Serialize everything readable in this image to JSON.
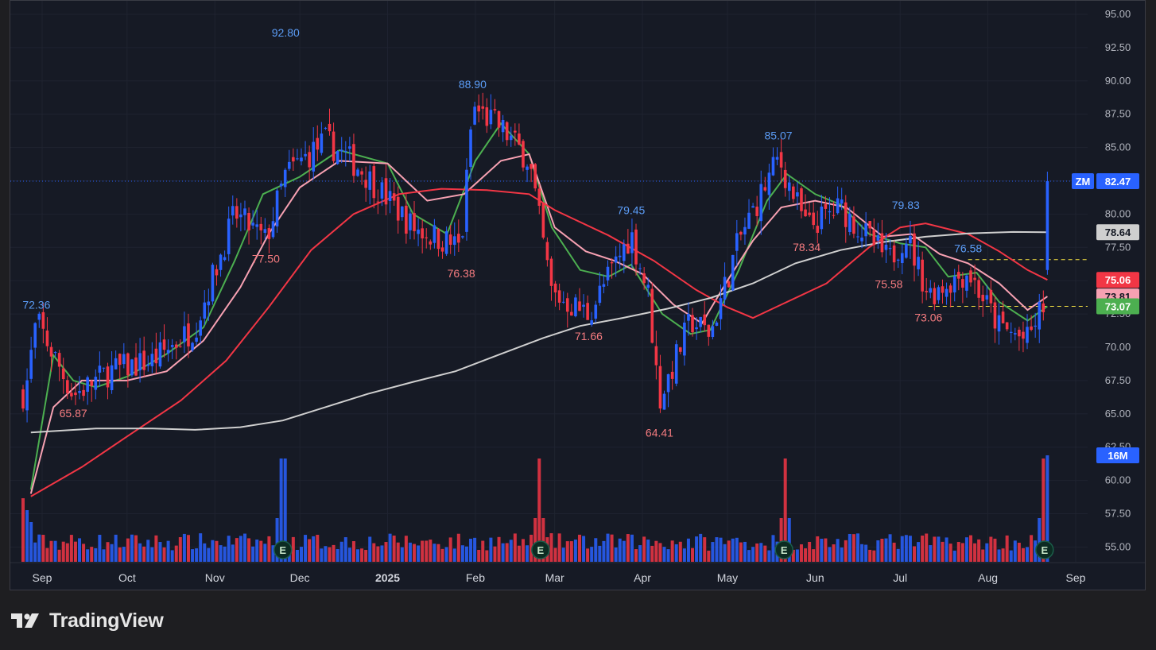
{
  "brand": {
    "name": "TradingView"
  },
  "chart_data": {
    "type": "candlestick",
    "symbol": "ZM",
    "last_price": "82.47",
    "ylim": [
      53.5,
      95.8
    ],
    "y_ticks": [
      "55.00",
      "57.50",
      "60.00",
      "62.50",
      "65.00",
      "67.50",
      "70.00",
      "72.50",
      "75.00",
      "77.50",
      "80.00",
      "82.50",
      "85.00",
      "87.50",
      "90.00",
      "92.50",
      "95.00"
    ],
    "x_ticks": [
      "Sep",
      "Oct",
      "Nov",
      "Dec",
      "2025",
      "Feb",
      "Mar",
      "Apr",
      "May",
      "Jun",
      "Jul",
      "Aug",
      "Sep"
    ],
    "bold_x_ticks": [
      "2025"
    ],
    "price_labels": [
      {
        "label": "ZM",
        "value": "82.47",
        "y": 82.47,
        "color": "#2962ff"
      },
      {
        "label": "",
        "value": "78.64",
        "y": 78.64,
        "color": "#cfcfcf"
      },
      {
        "label": "",
        "value": "75.06",
        "y": 75.06,
        "color": "#f23645"
      },
      {
        "label": "",
        "value": "73.81",
        "y": 73.81,
        "color": "#f7a1b2"
      },
      {
        "label": "",
        "value": "73.07",
        "y": 73.07,
        "color": "#4caf50"
      }
    ],
    "volume_label": "16M",
    "high_low_annotations": [
      {
        "text": "72.36",
        "x": "Aug 30",
        "y": 72.36,
        "kind": "high"
      },
      {
        "text": "65.87",
        "x": "Sep 12",
        "y": 65.87,
        "kind": "low"
      },
      {
        "text": "92.80",
        "x": "Nov 26",
        "y": 92.8,
        "kind": "high"
      },
      {
        "text": "77.50",
        "x": "Nov 19",
        "y": 77.5,
        "kind": "low"
      },
      {
        "text": "88.90",
        "x": "Jan 31",
        "y": 88.9,
        "kind": "high"
      },
      {
        "text": "76.38",
        "x": "Jan 27",
        "y": 76.38,
        "kind": "low"
      },
      {
        "text": "79.45",
        "x": "Mar 28",
        "y": 79.45,
        "kind": "high"
      },
      {
        "text": "71.66",
        "x": "Mar 13",
        "y": 71.66,
        "kind": "low"
      },
      {
        "text": "64.41",
        "x": "Apr 7",
        "y": 64.41,
        "kind": "low"
      },
      {
        "text": "85.07",
        "x": "May 19",
        "y": 85.07,
        "kind": "high"
      },
      {
        "text": "78.34",
        "x": "May 29",
        "y": 78.34,
        "kind": "low"
      },
      {
        "text": "75.58",
        "x": "Jun 27",
        "y": 75.58,
        "kind": "low"
      },
      {
        "text": "79.83",
        "x": "Jul 3",
        "y": 79.83,
        "kind": "high"
      },
      {
        "text": "73.06",
        "x": "Jul 11",
        "y": 73.06,
        "kind": "low"
      },
      {
        "text": "76.58",
        "x": "Jul 25",
        "y": 76.58,
        "kind": "high"
      }
    ],
    "earnings_markers": [
      "Nov 25",
      "Feb 24",
      "May 21",
      "Aug 21"
    ],
    "earnings_marker_letter": "E",
    "horizontal_lines": [
      {
        "y": 76.58,
        "color": "#f5e142",
        "style": "dashed"
      },
      {
        "y": 73.07,
        "color": "#f5e142",
        "style": "dashed"
      },
      {
        "y": 82.47,
        "color": "#2962ff",
        "style": "dotted"
      }
    ],
    "moving_averages": [
      {
        "color": "#4caf50",
        "points": [
          [
            "Aug 28",
            59.3
          ],
          [
            "Sep 5",
            69.4
          ],
          [
            "Sep 12",
            67.5
          ],
          [
            "Sep 20",
            67.0
          ],
          [
            "Oct 1",
            67.8
          ],
          [
            "Oct 15",
            69.5
          ],
          [
            "Oct 28",
            71.5
          ],
          [
            "Nov 8",
            76.5
          ],
          [
            "Nov 18",
            81.5
          ],
          [
            "Dec 1",
            82.8
          ],
          [
            "Dec 15",
            84.8
          ],
          [
            "Jan 1",
            83.8
          ],
          [
            "Jan 10",
            80.0
          ],
          [
            "Jan 22",
            78.5
          ],
          [
            "Feb 1",
            84.0
          ],
          [
            "Feb 10",
            86.8
          ],
          [
            "Feb 20",
            84.5
          ],
          [
            "Feb 28",
            79.0
          ],
          [
            "Mar 10",
            75.8
          ],
          [
            "Mar 20",
            75.3
          ],
          [
            "Mar 28",
            76.2
          ],
          [
            "Apr 8",
            72.5
          ],
          [
            "Apr 18",
            71.0
          ],
          [
            "Apr 25",
            71.3
          ],
          [
            "May 5",
            75.8
          ],
          [
            "May 15",
            81.0
          ],
          [
            "May 22",
            83.0
          ],
          [
            "Jun 1",
            81.5
          ],
          [
            "Jun 10",
            80.7
          ],
          [
            "Jun 20",
            78.5
          ],
          [
            "Jul 1",
            77.8
          ],
          [
            "Jul 10",
            77.5
          ],
          [
            "Jul 18",
            75.3
          ],
          [
            "Jul 28",
            75.6
          ],
          [
            "Aug 5",
            73.4
          ],
          [
            "Aug 15",
            72.0
          ],
          [
            "Aug 22",
            73.07
          ]
        ]
      },
      {
        "color": "#f7a1b2",
        "points": [
          [
            "Aug 28",
            59.0
          ],
          [
            "Sep 5",
            65.5
          ],
          [
            "Sep 15",
            67.5
          ],
          [
            "Oct 1",
            67.5
          ],
          [
            "Oct 15",
            68.2
          ],
          [
            "Oct 28",
            70.5
          ],
          [
            "Nov 10",
            74.5
          ],
          [
            "Nov 20",
            78.5
          ],
          [
            "Dec 1",
            82.0
          ],
          [
            "Dec 15",
            84.0
          ],
          [
            "Jan 1",
            83.8
          ],
          [
            "Jan 15",
            81.0
          ],
          [
            "Jan 28",
            81.5
          ],
          [
            "Feb 10",
            84.0
          ],
          [
            "Feb 20",
            84.5
          ],
          [
            "Mar 1",
            79.0
          ],
          [
            "Mar 12",
            77.2
          ],
          [
            "Mar 22",
            76.5
          ],
          [
            "Apr 1",
            75.5
          ],
          [
            "Apr 12",
            73.2
          ],
          [
            "Apr 22",
            71.8
          ],
          [
            "May 1",
            75.0
          ],
          [
            "May 10",
            78.0
          ],
          [
            "May 20",
            80.5
          ],
          [
            "Jun 1",
            81.0
          ],
          [
            "Jun 12",
            80.5
          ],
          [
            "Jun 25",
            78.3
          ],
          [
            "Jul 5",
            78.5
          ],
          [
            "Jul 15",
            77.0
          ],
          [
            "Jul 25",
            76.3
          ],
          [
            "Aug 5",
            74.8
          ],
          [
            "Aug 15",
            72.8
          ],
          [
            "Aug 22",
            73.81
          ]
        ]
      },
      {
        "color": "#f23645",
        "points": [
          [
            "Aug 28",
            58.8
          ],
          [
            "Sep 15",
            61.0
          ],
          [
            "Oct 1",
            63.3
          ],
          [
            "Oct 20",
            66.0
          ],
          [
            "Nov 5",
            69.0
          ],
          [
            "Nov 20",
            73.0
          ],
          [
            "Dec 5",
            77.3
          ],
          [
            "Dec 20",
            80.0
          ],
          [
            "Jan 5",
            81.5
          ],
          [
            "Jan 20",
            81.9
          ],
          [
            "Feb 5",
            81.8
          ],
          [
            "Feb 20",
            81.5
          ],
          [
            "Mar 1",
            80.3
          ],
          [
            "Mar 20",
            78.4
          ],
          [
            "Apr 5",
            76.5
          ],
          [
            "Apr 20",
            74.3
          ],
          [
            "May 1",
            73.0
          ],
          [
            "May 10",
            72.2
          ],
          [
            "May 20",
            73.2
          ],
          [
            "Jun 5",
            74.8
          ],
          [
            "Jun 20",
            77.5
          ],
          [
            "Jul 1",
            79.0
          ],
          [
            "Jul 10",
            79.3
          ],
          [
            "Jul 25",
            78.5
          ],
          [
            "Aug 5",
            77.2
          ],
          [
            "Aug 15",
            75.8
          ],
          [
            "Aug 22",
            75.06
          ]
        ]
      },
      {
        "color": "#cfcfcf",
        "points": [
          [
            "Aug 28",
            63.6
          ],
          [
            "Sep 20",
            63.9
          ],
          [
            "Oct 10",
            63.9
          ],
          [
            "Oct 25",
            63.8
          ],
          [
            "Nov 10",
            64.0
          ],
          [
            "Nov 25",
            64.5
          ],
          [
            "Dec 10",
            65.5
          ],
          [
            "Dec 25",
            66.5
          ],
          [
            "Jan 10",
            67.4
          ],
          [
            "Jan 25",
            68.2
          ],
          [
            "Feb 10",
            69.5
          ],
          [
            "Feb 25",
            70.7
          ],
          [
            "Mar 10",
            71.6
          ],
          [
            "Mar 25",
            72.2
          ],
          [
            "Apr 10",
            72.9
          ],
          [
            "Apr 25",
            73.7
          ],
          [
            "May 10",
            74.8
          ],
          [
            "May 25",
            76.3
          ],
          [
            "Jun 10",
            77.3
          ],
          [
            "Jun 25",
            77.9
          ],
          [
            "Jul 10",
            78.3
          ],
          [
            "Jul 25",
            78.55
          ],
          [
            "Aug 10",
            78.66
          ],
          [
            "Aug 22",
            78.64
          ]
        ]
      }
    ]
  }
}
